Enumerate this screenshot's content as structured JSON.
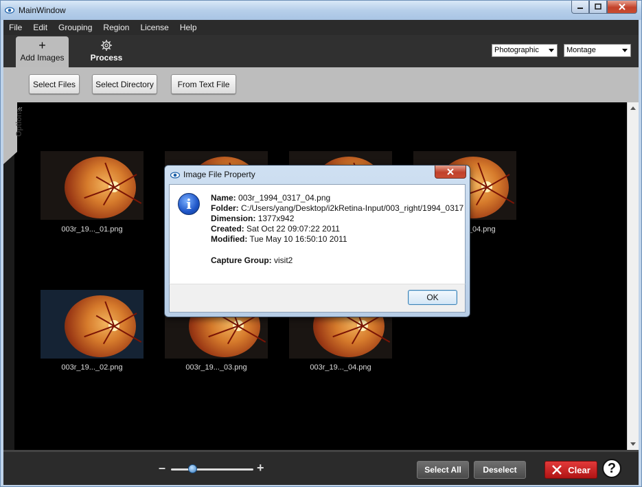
{
  "window": {
    "title": "MainWindow"
  },
  "menu": [
    "File",
    "Edit",
    "Grouping",
    "Region",
    "License",
    "Help"
  ],
  "toolbar": {
    "add_images": "Add Images",
    "process": "Process",
    "mode_select": "Photographic",
    "layout_select": "Montage"
  },
  "subbar": {
    "select_files": "Select Files",
    "select_directory": "Select Directory",
    "from_text_file": "From Text File"
  },
  "sidepanel": {
    "options_label": "Options"
  },
  "thumbnails": [
    {
      "label": "003r_19..._01.png",
      "tint": "warm"
    },
    {
      "label": "",
      "tint": "warm"
    },
    {
      "label": "",
      "tint": "warm"
    },
    {
      "label": "003r_19..._04.png",
      "tint": "warm"
    },
    {
      "label": "003r_19..._02.png",
      "tint": "blue"
    },
    {
      "label": "003r_19..._03.png",
      "tint": "warm"
    },
    {
      "label": "003r_19..._04.png",
      "tint": "warm"
    }
  ],
  "bottombar": {
    "zoom_minus": "–",
    "zoom_plus": "+",
    "zoom_level": 0.27,
    "select_all": "Select All",
    "deselect": "Deselect",
    "clear": "Clear",
    "help": "?"
  },
  "dialog": {
    "title": "Image File Property",
    "name_label": "Name:",
    "name_value": "003r_1994_0317_04.png",
    "folder_label": "Folder:",
    "folder_value": "C:/Users/yang/Desktop/i2kRetina-Input/003_right/1994_0317",
    "dimension_label": "Dimension:",
    "dimension_value": "1377x942",
    "created_label": "Created:",
    "created_value": "Sat Oct 22 09:07:22 2011",
    "modified_label": "Modified:",
    "modified_value": "Tue May 10 16:50:10 2011",
    "group_label": "Capture Group:",
    "group_value": "visit2",
    "ok": "OK"
  }
}
